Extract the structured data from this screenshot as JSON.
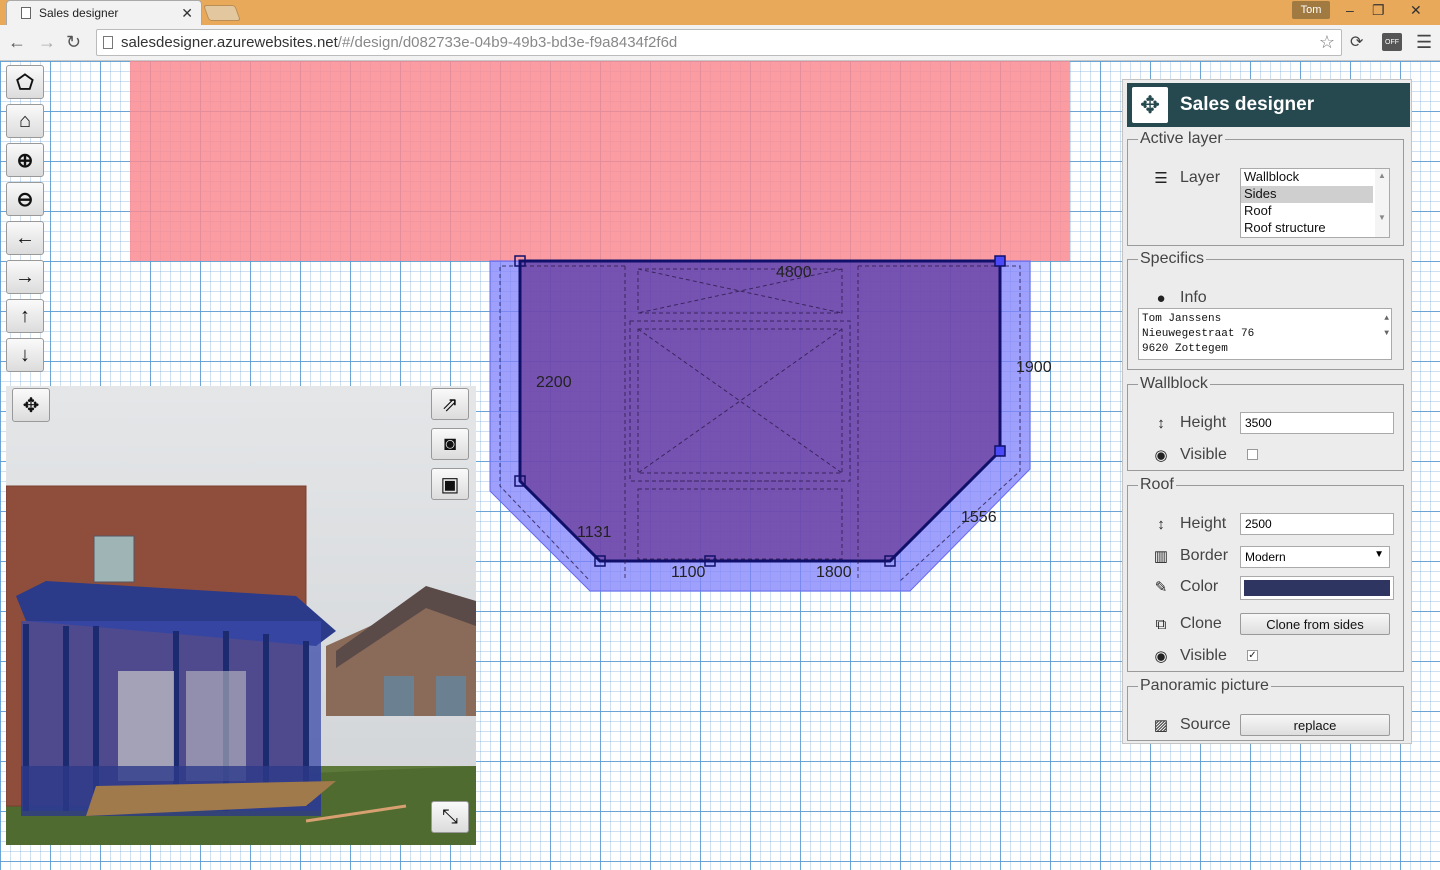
{
  "browser": {
    "tab_title": "Sales designer",
    "user": "Tom",
    "url_host": "salesdesigner.azurewebsites.net",
    "url_path": "/#/design/d082733e-04b9-49b3-bd3e-f9a8434f2f6d",
    "ext_off_label": "OFF"
  },
  "tools": [
    "select-tool",
    "home",
    "zoom-in",
    "zoom-out",
    "pan-left",
    "pan-right",
    "pan-up",
    "pan-down"
  ],
  "dimensions": {
    "top": "4800",
    "left": "2200",
    "right": "1900",
    "diag_left": "1131",
    "diag_right": "1556",
    "bottom_left": "1100",
    "bottom_right": "1800"
  },
  "colors": {
    "wall_fill": "#f98b92",
    "sides_fill": "#7f7ffb",
    "sides_outline": "#1a1a8a",
    "panel_header": "#25494f",
    "roof_color": "#2e3561"
  },
  "panel": {
    "title": "Sales designer",
    "active_layer": {
      "legend": "Active layer",
      "label": "Layer",
      "options": [
        "Wallblock",
        "Sides",
        "Roof",
        "Roof structure"
      ],
      "selected": "Sides"
    },
    "specifics": {
      "legend": "Specifics",
      "label": "Info",
      "lines": [
        "Tom Janssens",
        "Nieuwegestraat 76",
        "9620 Zottegem"
      ]
    },
    "wallblock": {
      "legend": "Wallblock",
      "height_label": "Height",
      "height_value": "3500",
      "visible_label": "Visible",
      "visible": false
    },
    "roof": {
      "legend": "Roof",
      "height_label": "Height",
      "height_value": "2500",
      "border_label": "Border",
      "border_value": "Modern",
      "color_label": "Color",
      "clone_label": "Clone",
      "clone_button": "Clone from sides",
      "visible_label": "Visible",
      "visible": true
    },
    "panoramic": {
      "legend": "Panoramic picture",
      "source_label": "Source",
      "replace_button": "replace"
    }
  }
}
